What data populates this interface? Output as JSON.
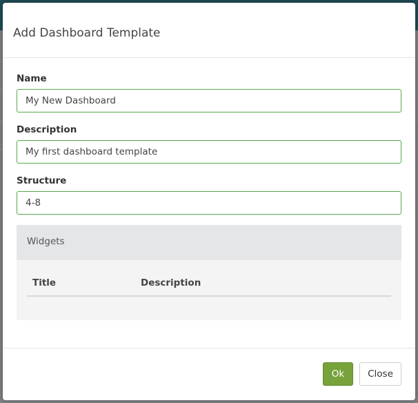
{
  "dialog": {
    "title": "Add Dashboard Template"
  },
  "form": {
    "name_label": "Name",
    "name_value": "My New Dashboard",
    "description_label": "Description",
    "description_value": "My first dashboard template",
    "structure_label": "Structure",
    "structure_value": "4-8"
  },
  "widgets": {
    "heading": "Widgets",
    "columns": [
      "Title",
      "Description"
    ],
    "rows": []
  },
  "footer": {
    "ok_label": "Ok",
    "close_label": "Close"
  },
  "colors": {
    "input_border": "#58a84c",
    "ok_button": "#77a33a",
    "backdrop_header": "#1f4a55"
  }
}
